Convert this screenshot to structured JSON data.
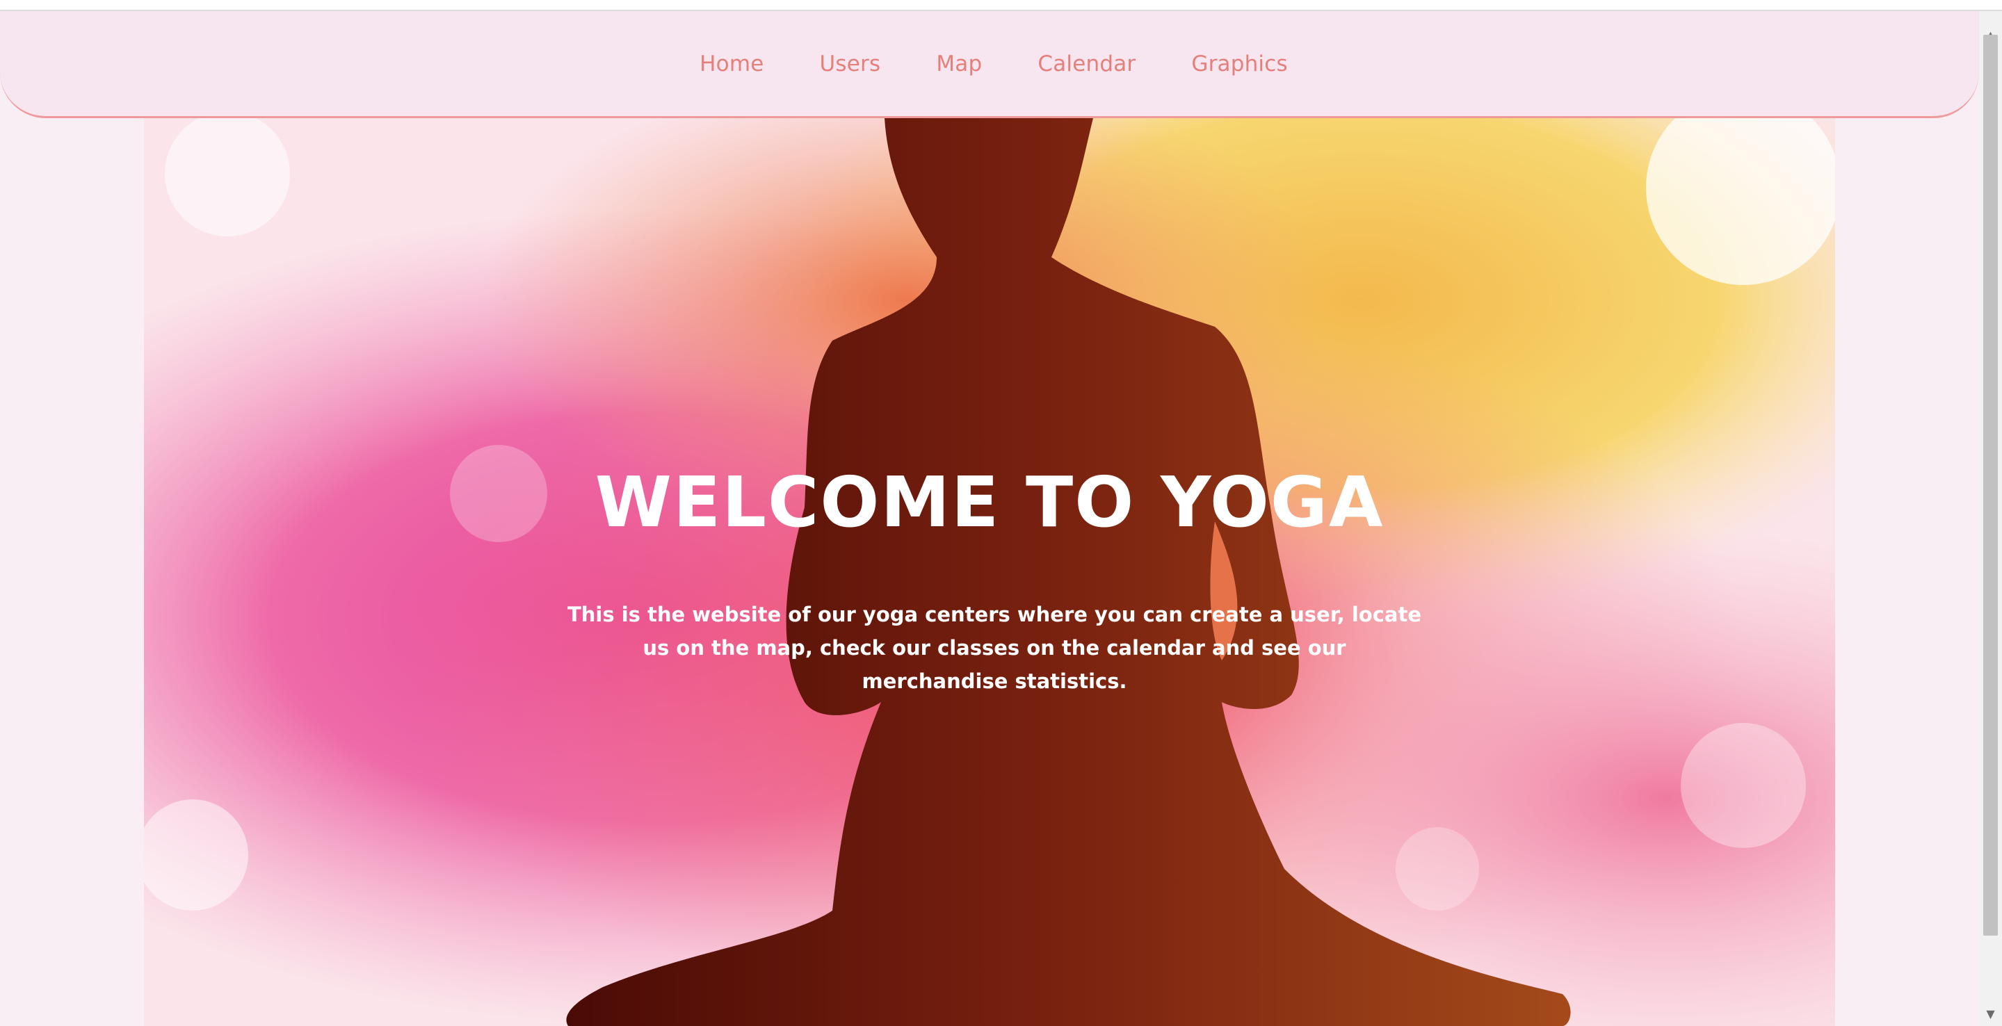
{
  "nav": {
    "items": [
      {
        "label": "Home"
      },
      {
        "label": "Users"
      },
      {
        "label": "Map"
      },
      {
        "label": "Calendar"
      },
      {
        "label": "Graphics"
      }
    ]
  },
  "hero": {
    "title": "WELCOME TO YOGA",
    "description": "This is the website of our yoga centers where you can create a user, locate us on the map, check our classes on the calendar and see our merchandise statistics."
  },
  "colors": {
    "nav_background": "#f7e6ef",
    "nav_text": "#e47f7a",
    "nav_border": "#ef9a9a",
    "page_background": "#f8eef4",
    "hero_text": "#ffffff",
    "silhouette": "#6e1f0f"
  },
  "icons": {
    "scroll_up": "triangle-up-icon",
    "scroll_down": "triangle-down-icon"
  }
}
